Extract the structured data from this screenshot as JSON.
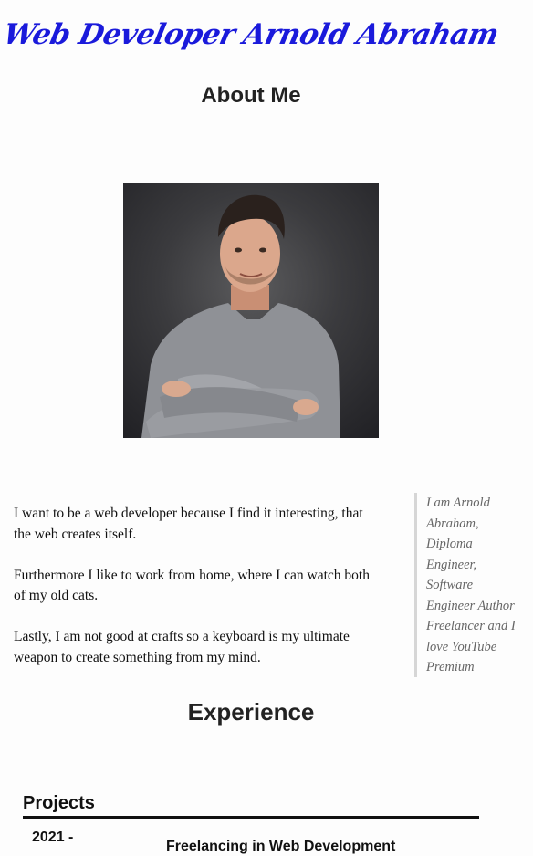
{
  "header": {
    "site_title": "Web Developer Arnold Abraham"
  },
  "about": {
    "heading": "About Me",
    "portrait_alt": "Portrait of Arnold Abraham",
    "paragraphs": [
      "I want to be a web developer because I find it interesting, that the web creates itself.",
      "Furthermore I like to work from home, where I can watch both of my old cats.",
      "Lastly, I am not good at crafts so a keyboard is my ultimate weapon to create something from my mind."
    ],
    "quote": "I am Arnold Abraham, Diploma Engineer, Software Engineer Author Freelancer and I love YouTube Premium"
  },
  "experience": {
    "heading": "Experience",
    "projects_heading": "Projects",
    "projects": [
      {
        "date": "2021 -",
        "title": "Freelancing in Web Development"
      }
    ]
  },
  "colors": {
    "title_blue": "#1a1adb",
    "text": "#111111",
    "quote_text": "#666666",
    "quote_border": "#d6d6d6"
  }
}
